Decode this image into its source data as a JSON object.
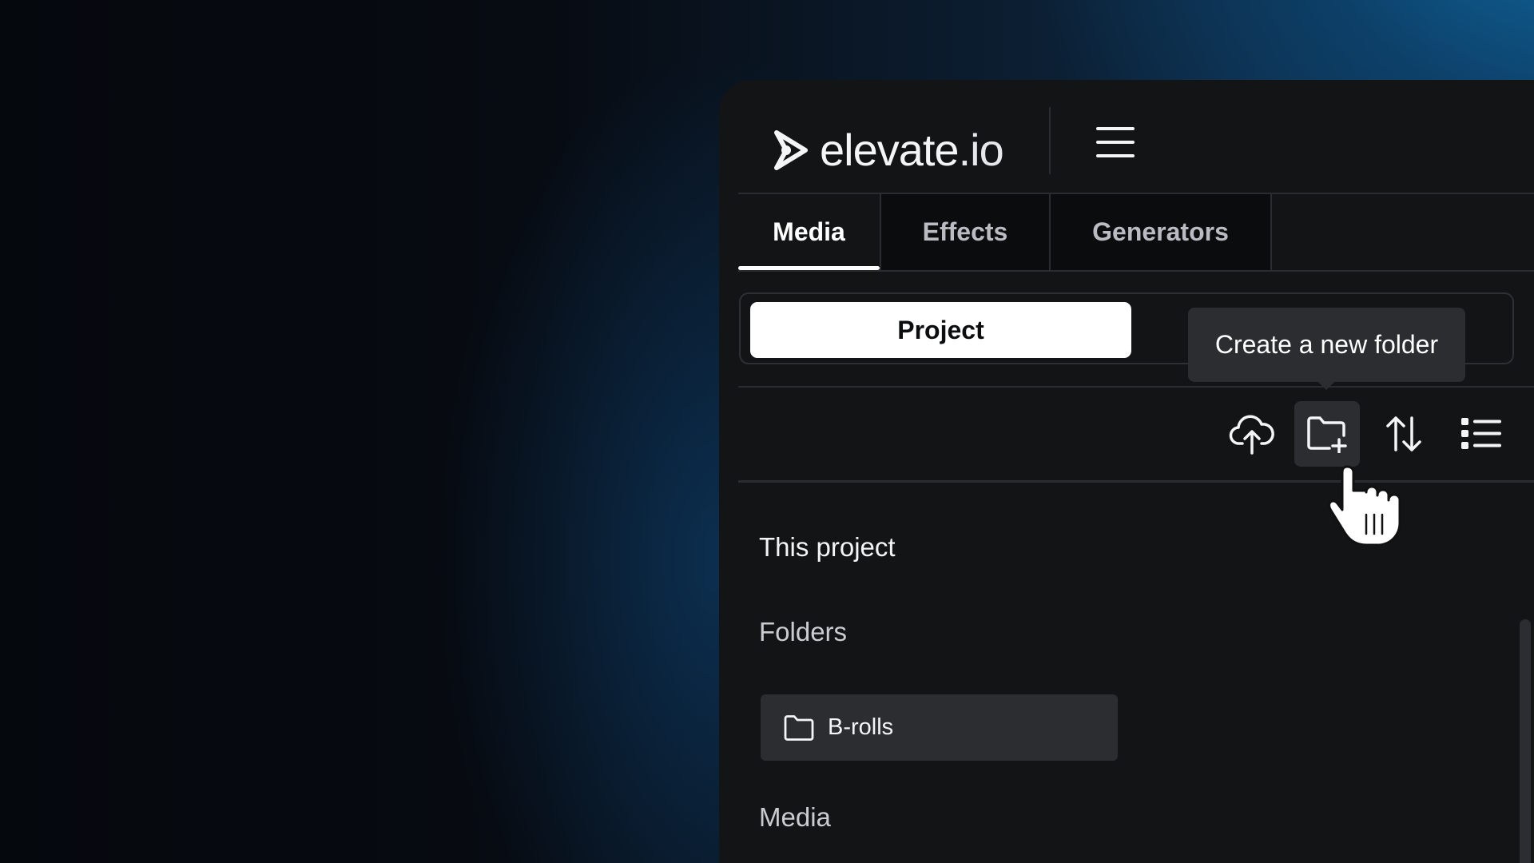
{
  "brand": {
    "name": "elevate",
    "tld": ".io"
  },
  "header": {
    "menu_icon": "hamburger-menu-icon"
  },
  "tabs": [
    {
      "label": "Media",
      "active": true
    },
    {
      "label": "Effects",
      "active": false
    },
    {
      "label": "Generators",
      "active": false
    }
  ],
  "scope": {
    "selected": "Project"
  },
  "tooltip": {
    "text": "Create a new folder"
  },
  "toolbar": {
    "icons": [
      "cloud-upload-icon",
      "new-folder-icon",
      "sort-icon",
      "list-view-icon"
    ],
    "hovered": "new-folder-icon"
  },
  "content": {
    "section_title": "This project",
    "folders_label": "Folders",
    "folders": [
      {
        "name": "B-rolls",
        "icon": "folder-icon"
      }
    ],
    "media_label": "Media"
  },
  "colors": {
    "panel": "#131416",
    "accent": "#ffffff",
    "card": "#2c2d31"
  }
}
